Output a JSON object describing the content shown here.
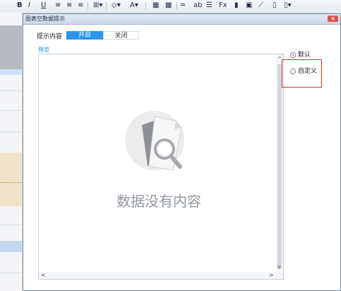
{
  "toolbar": {
    "icons": [
      {
        "name": "bold-icon",
        "glyph": "B"
      },
      {
        "name": "italic-icon",
        "glyph": "I"
      },
      {
        "name": "underline-icon",
        "glyph": "U"
      },
      {
        "name": "align-left-icon",
        "glyph": "≡"
      },
      {
        "name": "align-center-icon",
        "glyph": "≡"
      },
      {
        "name": "align-right-icon",
        "glyph": "≡"
      },
      {
        "name": "border-icon",
        "glyph": "⊞▾"
      },
      {
        "name": "fill-color-icon",
        "glyph": "◇▾"
      },
      {
        "name": "font-color-icon",
        "glyph": "A▾"
      },
      {
        "name": "grid-icon",
        "glyph": "▦"
      },
      {
        "name": "table-icon",
        "glyph": "▦"
      },
      {
        "name": "merge-icon",
        "glyph": "═"
      },
      {
        "name": "text-icon",
        "glyph": "ab"
      },
      {
        "name": "paragraph-icon",
        "glyph": "☰"
      },
      {
        "name": "formula-icon",
        "glyph": "Fx"
      },
      {
        "name": "chart-icon",
        "glyph": "▮"
      },
      {
        "name": "image-icon",
        "glyph": "▣"
      },
      {
        "name": "slash-icon",
        "glyph": "⟋"
      },
      {
        "name": "sheet-icon",
        "glyph": "▯"
      },
      {
        "name": "insert-icon",
        "glyph": "▯▾"
      }
    ]
  },
  "dialog": {
    "title": "图表空数据提示",
    "close_glyph": "✕",
    "prompt_label": "提示内容",
    "toggle_on": "开启",
    "toggle_off": "关闭",
    "preview_label": "预览",
    "empty_text": "数据没有内容",
    "options": [
      {
        "label": "默认",
        "checked": true
      },
      {
        "label": "自定义",
        "checked": false
      }
    ],
    "scroll_up": "^",
    "scroll_down": "v",
    "scroll_left": "<",
    "scroll_right": ">"
  },
  "colors": {
    "accent": "#2b95ef",
    "highlight": "#e23030",
    "empty_text": "#8f969e"
  },
  "status": {
    "zoom_glyph": "+"
  }
}
